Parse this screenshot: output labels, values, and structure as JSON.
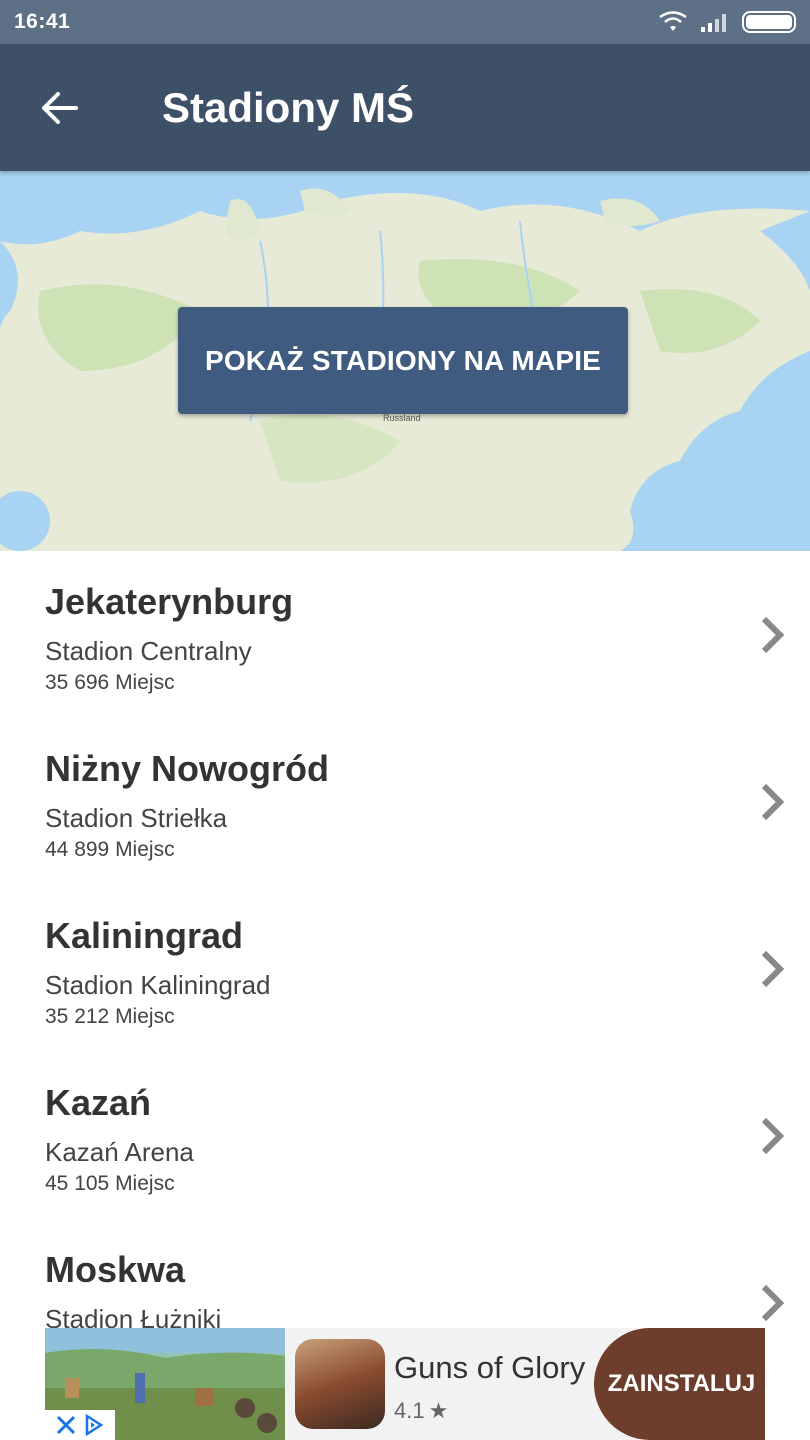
{
  "status_bar": {
    "time": "16:41"
  },
  "app_bar": {
    "title": "Stadiony MŚ"
  },
  "map": {
    "button_label": "POKAŻ STADIONY NA MAPIE",
    "center_label": "Russland"
  },
  "stadiums": [
    {
      "city": "Jekaterynburg",
      "stadium": "Stadion Centralny",
      "capacity": "35 696 Miejsc"
    },
    {
      "city": "Niżny Nowogród",
      "stadium": "Stadion Striełka",
      "capacity": "44 899 Miejsc"
    },
    {
      "city": "Kaliningrad",
      "stadium": "Stadion Kaliningrad",
      "capacity": "35 212 Miejsc"
    },
    {
      "city": "Kazań",
      "stadium": "Kazań Arena",
      "capacity": "45 105 Miejsc"
    },
    {
      "city": "Moskwa",
      "stadium": "Stadion Łużniki",
      "capacity": ""
    }
  ],
  "ad": {
    "title": "Guns of Glory",
    "rating": "4.1",
    "cta": "ZAINSTALUJ"
  },
  "colors": {
    "status_bar": "#5d7085",
    "app_bar": "#3d5068",
    "map_button": "#3f5b80",
    "ad_cta": "#6d3e2c"
  }
}
